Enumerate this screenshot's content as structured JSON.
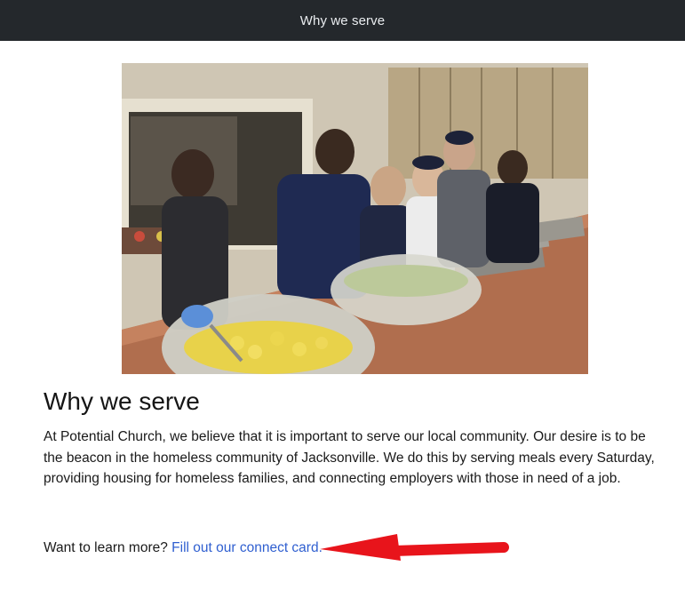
{
  "header": {
    "title": "Why we serve"
  },
  "main": {
    "heading": "Why we serve",
    "paragraph": "At Potential Church, we believe that it is important to serve our local community. Our desire is to be the beacon in the homeless community of Jacksonville. We do this by serving meals every Saturday, providing housing for homeless families, and connecting employers with those in need of a job.",
    "cta_prefix": "Want to learn more?",
    "cta_link": "Fill out our connect card."
  },
  "colors": {
    "topbar": "#24282c",
    "link": "#2f5fd0",
    "annotation_arrow": "#e8141b"
  }
}
